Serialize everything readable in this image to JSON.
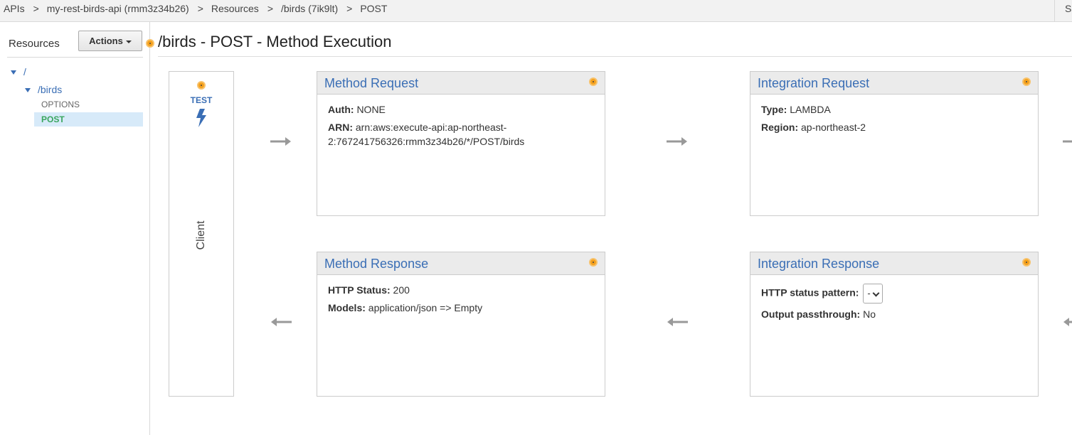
{
  "breadcrumb": {
    "items": [
      "APIs",
      "my-rest-birds-api (rmm3z34b26)",
      "Resources",
      "/birds (7ik9lt)",
      "POST"
    ],
    "separator": ">"
  },
  "top_right_label": "S",
  "sidebar": {
    "title": "Resources",
    "actions_label": "Actions",
    "tree": {
      "root": "/",
      "child": "/birds",
      "methods": [
        "OPTIONS",
        "POST"
      ],
      "selected_method": "POST"
    }
  },
  "page_title": "/birds - POST - Method Execution",
  "client": {
    "test_label": "TEST",
    "label": "Client"
  },
  "method_request": {
    "title": "Method Request",
    "auth_key": "Auth:",
    "auth_value": "NONE",
    "arn_key": "ARN:",
    "arn_value": "arn:aws:execute-api:ap-northeast-2:767241756326:rmm3z34b26/*/POST/birds"
  },
  "integration_request": {
    "title": "Integration Request",
    "type_key": "Type:",
    "type_value": "LAMBDA",
    "region_key": "Region:",
    "region_value": "ap-northeast-2"
  },
  "method_response": {
    "title": "Method Response",
    "status_key": "HTTP Status:",
    "status_value": "200",
    "models_key": "Models:",
    "models_value": "application/json => Empty"
  },
  "integration_response": {
    "title": "Integration Response",
    "pattern_key": "HTTP status pattern:",
    "pattern_value": "-",
    "passthrough_key": "Output passthrough:",
    "passthrough_value": "No"
  },
  "colors": {
    "accent_blue": "#3a6eb5",
    "indicator_orange": "#f5a11d",
    "selected_green": "#3aa65e",
    "arrow_gray": "#999999"
  },
  "icons": [
    "info-dot-icon",
    "lightning-bolt-icon",
    "arrow-right-icon",
    "arrow-left-icon",
    "chevron-down-icon"
  ]
}
